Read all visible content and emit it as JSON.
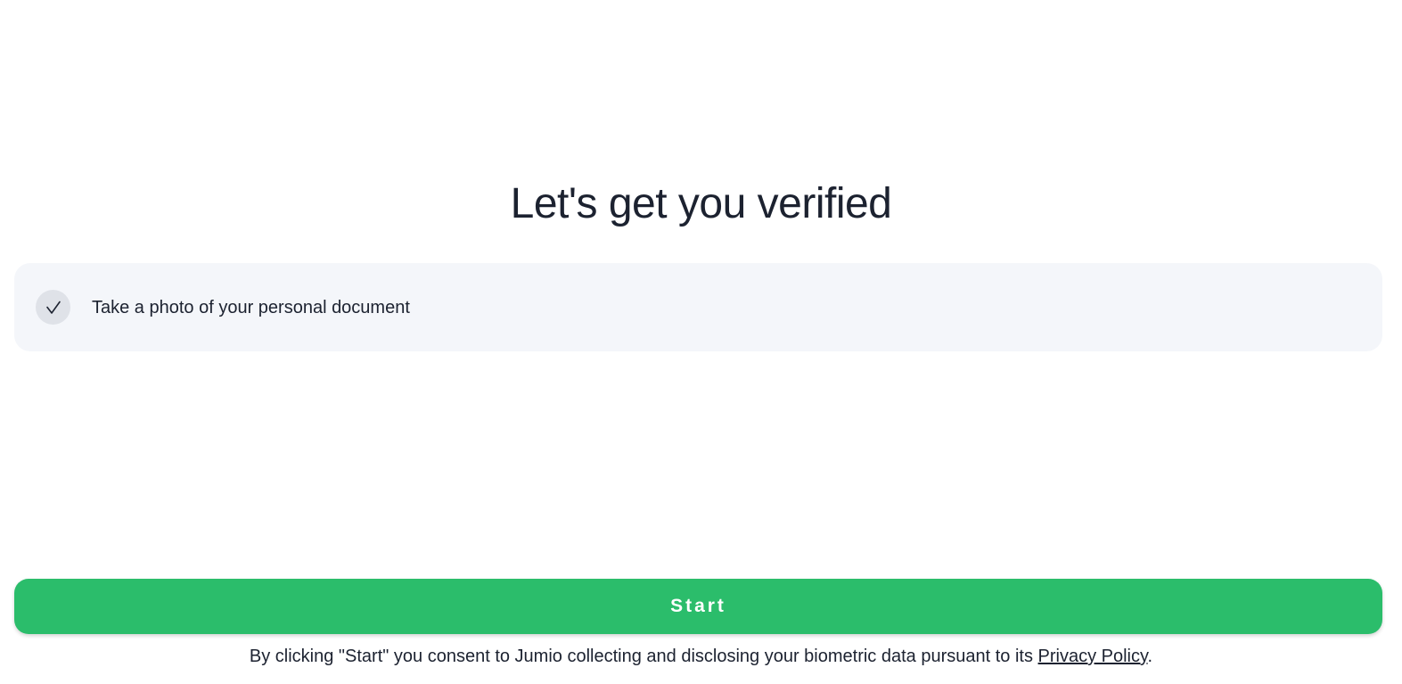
{
  "title": "Let's get you verified",
  "steps": [
    {
      "label": "Take a photo of your personal document",
      "icon": "check-icon"
    }
  ],
  "start_button": {
    "label": "Start"
  },
  "consent": {
    "text_before": "By clicking \"Start\" you consent to Jumio collecting and disclosing your biometric data pursuant to its ",
    "link_label": "Privacy Policy",
    "text_after": "."
  },
  "colors": {
    "accent": "#2bbd6b",
    "card_background": "#f4f6fa",
    "text": "#1c2230"
  }
}
